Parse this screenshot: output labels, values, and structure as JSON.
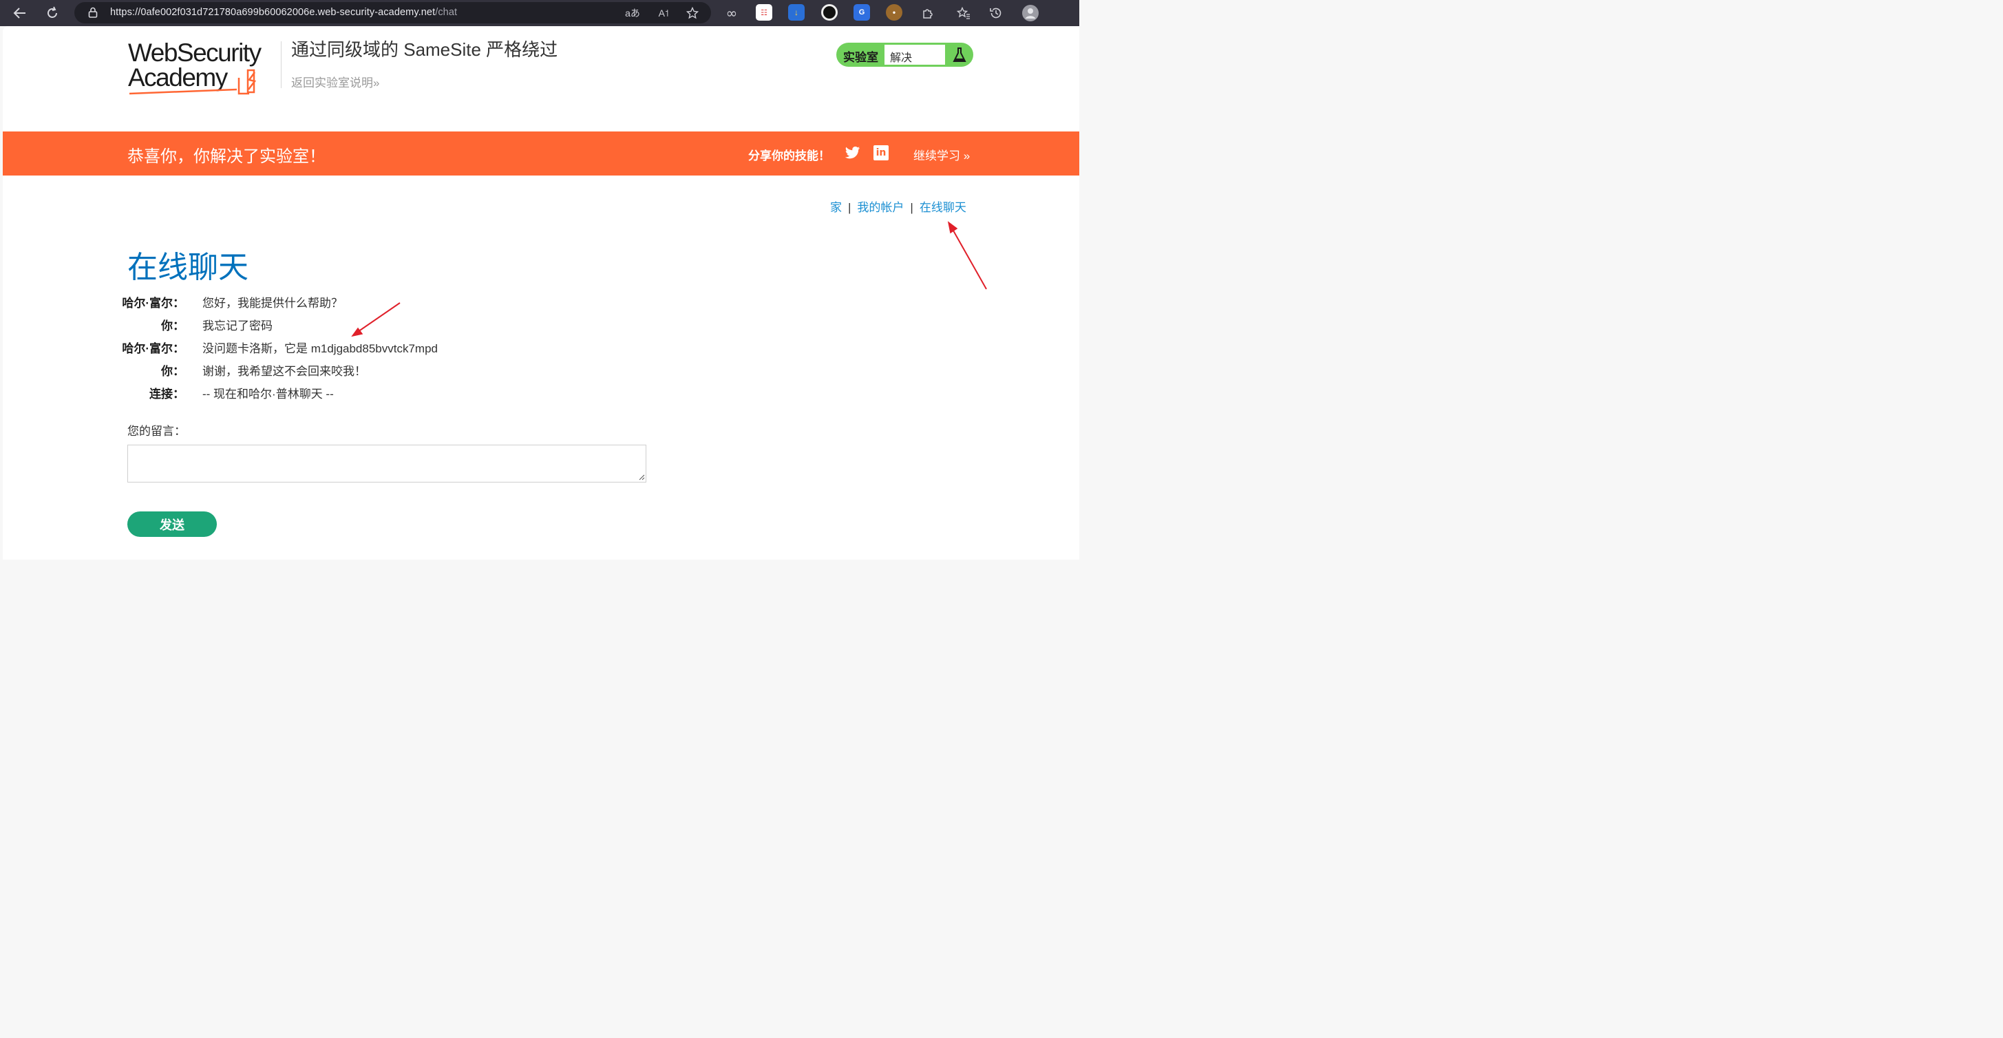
{
  "browser": {
    "url_host": "https://0afe002f031d721780a699b60062006e.web-security-academy.net",
    "url_path": "/chat",
    "icons": [
      "back-icon",
      "refresh-icon",
      "lock-icon",
      "translate-icon",
      "read-aloud-icon",
      "favorite-icon",
      "infinity-icon",
      "extension-icons",
      "extensions-icon",
      "favorites-icon",
      "history-icon",
      "profile-icon"
    ]
  },
  "header": {
    "logo_line_1": "WebSecurity",
    "logo_line_2": "Academy",
    "lab_title": "通过同级域的 SameSite 严格绕过",
    "back_link": "返回实验室说明",
    "back_link_chevron": "»",
    "lab_status_label": "实验室",
    "lab_status_value": "解决"
  },
  "banner": {
    "text": "恭喜你，你解决了实验室！",
    "share": "分享你的技能！",
    "continue": "继续学习",
    "continue_chevron": "»"
  },
  "nav": {
    "home": "家",
    "account": "我的帐户",
    "chat": "在线聊天",
    "separator": "|"
  },
  "chat": {
    "title": "在线聊天",
    "messages": [
      {
        "speaker": "哈尔·富尔：",
        "text": "您好，我能提供什么帮助？"
      },
      {
        "speaker": "你：",
        "text": "我忘记了密码"
      },
      {
        "speaker": "哈尔·富尔：",
        "text": "没问题卡洛斯，它是 m1djgabd85bvvtck7mpd"
      },
      {
        "speaker": "你：",
        "text": "谢谢，我希望这不会回来咬我！"
      },
      {
        "speaker": "连接：",
        "text": "-- 现在和哈尔·普林聊天 --"
      }
    ],
    "message_label": "您的留言：",
    "send_label": "发送"
  },
  "colors": {
    "banner": "#ff6633",
    "lab_solved": "#70d05b",
    "link": "#1b8fd2",
    "title": "#0071bc",
    "send_button": "#1da578",
    "annotation_arrow": "#e0202a"
  }
}
